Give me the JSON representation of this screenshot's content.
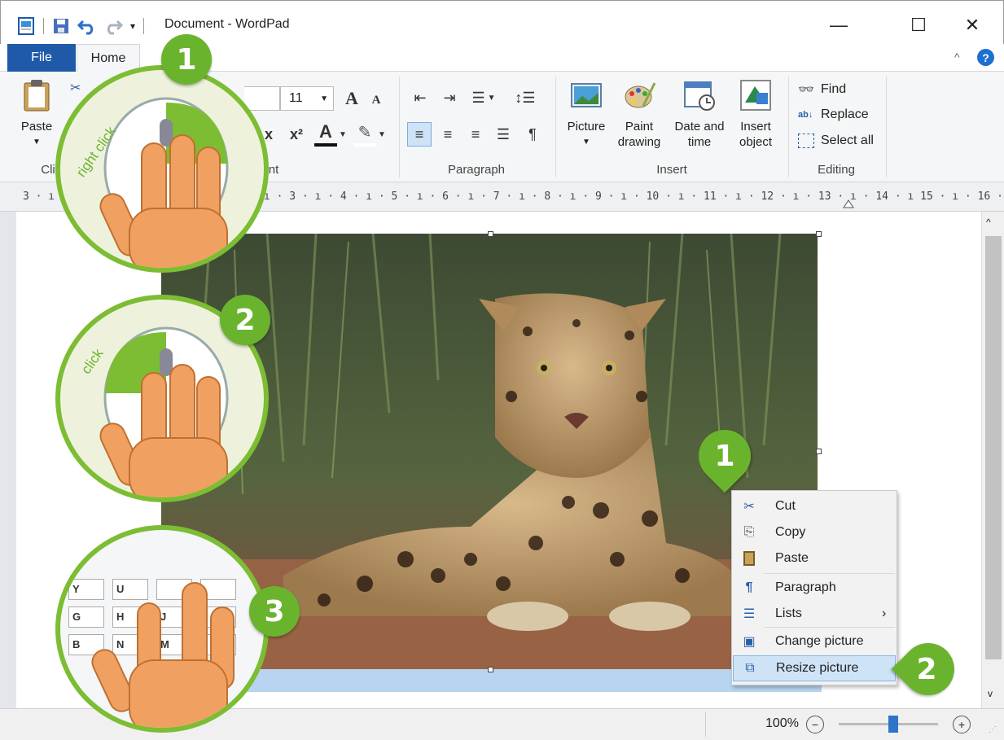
{
  "window": {
    "title": "Document - WordPad",
    "minimize": "—",
    "maximize": "☐",
    "close": "✕",
    "help": "?",
    "collapse": "^"
  },
  "tabs": {
    "file": "File",
    "home": "Home"
  },
  "ribbon": {
    "clipboard": {
      "paste": "Paste",
      "label_visible": "Cli"
    },
    "font": {
      "size": "11",
      "label_visible": "nt",
      "grow": "A",
      "shrink": "A",
      "subscript": "x",
      "superscript": "x²",
      "color_a": "A"
    },
    "paragraph": {
      "label": "Paragraph"
    },
    "insert": {
      "picture": "Picture",
      "paint_line1": "Paint",
      "paint_line2": "drawing",
      "date_line1": "Date and",
      "date_line2": "time",
      "insert_line1": "Insert",
      "insert_line2": "object",
      "label": "Insert"
    },
    "editing": {
      "find": "Find",
      "replace": "Replace",
      "select_all": "Select all",
      "label": "Editing"
    }
  },
  "ruler": {
    "text_left": "3 · ı",
    "text_main": "ı · 3 · ı · 4 · ı · 5 · ı · 6 · ı · 7 · ı · 8 · ı · 9 · ı · 10 · ı · 11 · ı · 12 · ı · 13 · ı · 14 · ı 15 · ı · 16 · ı · 17 · ı"
  },
  "context_menu": {
    "items": [
      {
        "label": "Cut",
        "icon": "scissors-icon",
        "glyph": "✂"
      },
      {
        "label": "Copy",
        "icon": "copy-icon",
        "glyph": "⎘"
      },
      {
        "label": "Paste",
        "icon": "paste-icon",
        "glyph": "📋"
      },
      {
        "label": "Paragraph",
        "icon": "paragraph-icon",
        "glyph": "¶"
      },
      {
        "label": "Lists",
        "icon": "list-icon",
        "glyph": "☰",
        "submenu": "›"
      },
      {
        "label": "Change picture",
        "icon": "change-picture-icon",
        "glyph": "▣"
      },
      {
        "label": "Resize picture",
        "icon": "resize-picture-icon",
        "glyph": "⧉"
      }
    ]
  },
  "status": {
    "zoom": "100%",
    "zoom_out": "−",
    "zoom_in": "+",
    "zoom_level": 0.55
  },
  "tutorial": {
    "step1": "1",
    "step2": "2",
    "step3": "3",
    "right_click": "right click",
    "click": "click",
    "keyboard_keys": [
      "Y",
      "U",
      "G",
      "H",
      "J",
      "B",
      "N",
      "M"
    ]
  },
  "colors": {
    "accent_green": "#6ab42d",
    "file_tab": "#1e5aa8",
    "selection": "#b7d5f0"
  }
}
